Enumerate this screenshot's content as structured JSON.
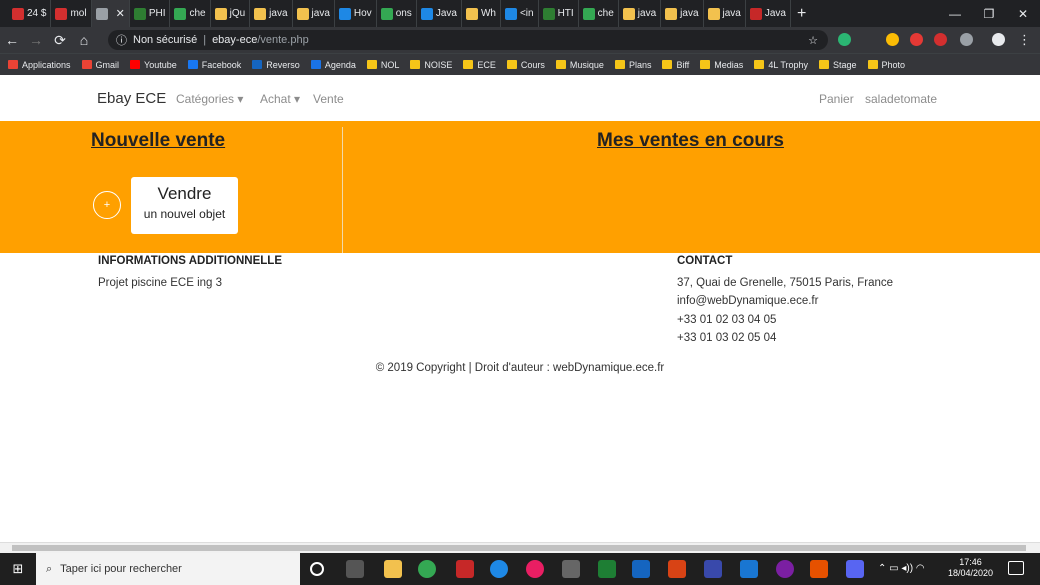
{
  "browser": {
    "tabs": [
      "24 $",
      "mol",
      "",
      "PHI",
      "che",
      "jQu",
      "java",
      "java",
      "Hov",
      "ons",
      "Java",
      "Wh",
      "<in",
      "HTI",
      "che",
      "java",
      "java",
      "java",
      "Java"
    ],
    "active_tab_index": 2,
    "new_tab": "+",
    "security_label": "Non sécurisé",
    "url_host": "ebay-ece",
    "url_path": "/vente.php",
    "bookmarks": [
      "Applications",
      "Gmail",
      "Youtube",
      "Facebook",
      "Reverso",
      "Agenda",
      "NOL",
      "NOISE",
      "ECE",
      "Cours",
      "Musique",
      "Plans",
      "Biff",
      "Medias",
      "4L Trophy",
      "Stage",
      "Photo"
    ]
  },
  "navbar": {
    "brand": "Ebay ECE",
    "categories": "Catégories ▾",
    "achat": "Achat ▾",
    "vente": "Vente",
    "panier": "Panier",
    "user": "saladetomate"
  },
  "main": {
    "left_title": "Nouvelle vente",
    "right_title": "Mes ventes en cours",
    "plus_label": "+",
    "sell_title": "Vendre",
    "sell_subtitle": "un nouvel objet",
    "accent_color": "#ffa000"
  },
  "footer": {
    "info_heading": "INFORMATIONS ADDITIONNELLE",
    "info_text": "Projet piscine ECE ing 3",
    "contact_heading": "CONTACT",
    "address": "37, Quai de Grenelle, 75015 Paris, France",
    "email": "info@webDynamique.ece.fr",
    "phone1": "+33 01 02 03 04 05",
    "phone2": "+33 01 03 02 05 04",
    "copyright": "© 2019 Copyright | Droit d'auteur : webDynamique.ece.fr"
  },
  "taskbar": {
    "search_placeholder": "Taper ici pour rechercher",
    "time": "17:46",
    "date": "18/04/2020"
  }
}
